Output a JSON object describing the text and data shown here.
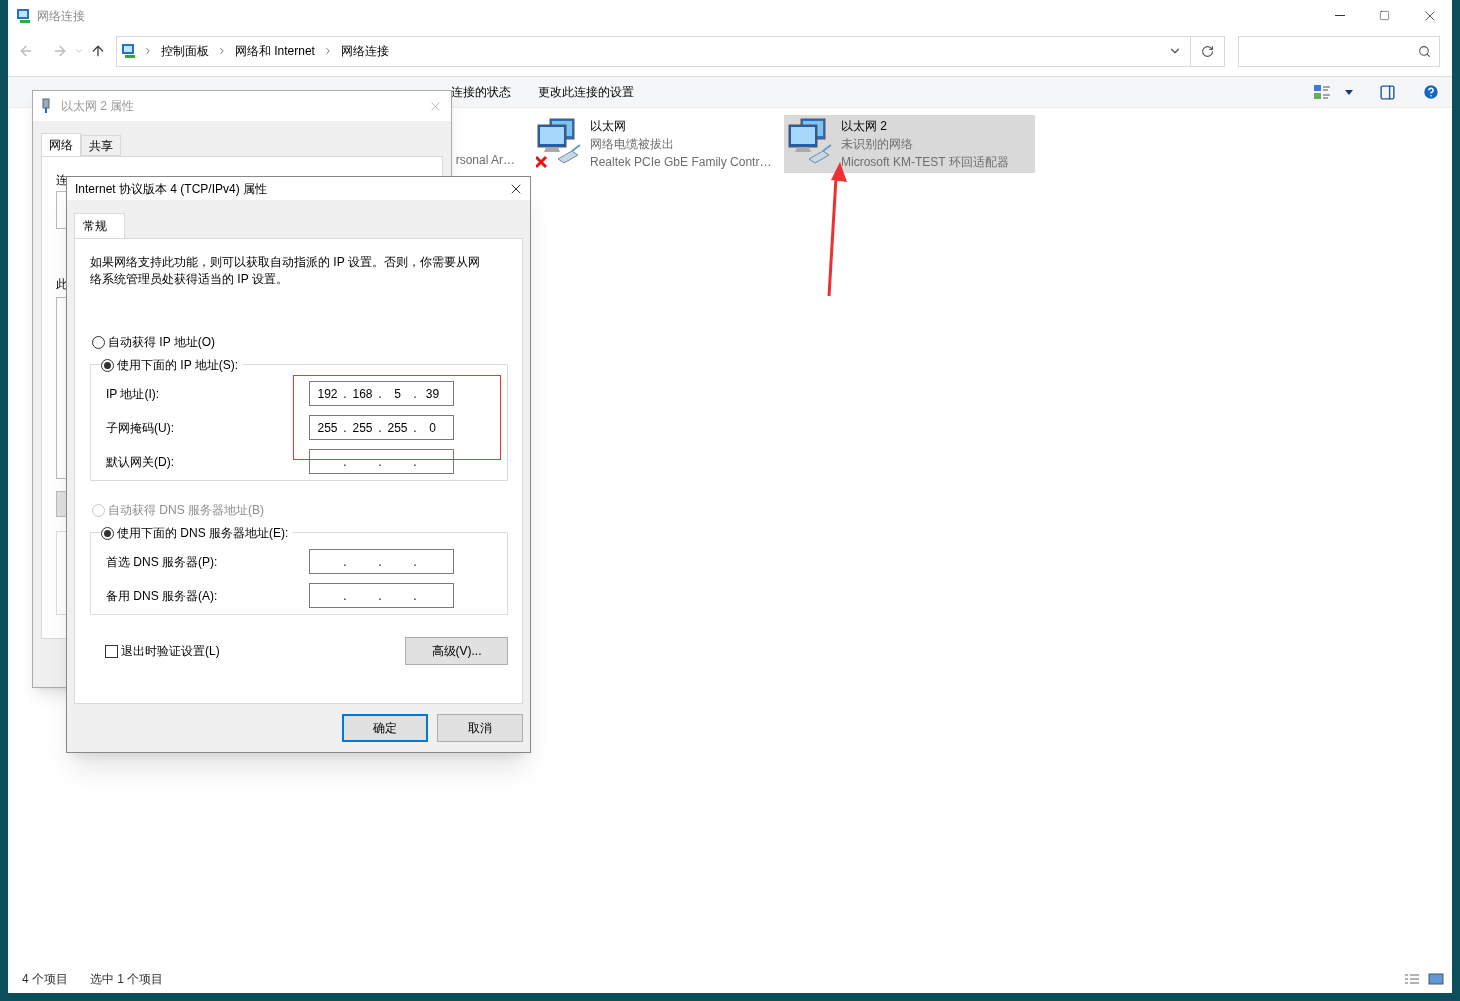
{
  "window": {
    "title": "网络连接"
  },
  "address_bar": {
    "path": [
      "控制面板",
      "网络和 Internet",
      "网络连接"
    ]
  },
  "toolbar": {
    "items": [
      {
        "label": "连接的状态"
      },
      {
        "label": "更改此连接的设置"
      }
    ]
  },
  "connections": [
    {
      "device": "rsonal Ar…",
      "selected": false
    },
    {
      "name": "以太网",
      "status": "网络电缆被拔出",
      "device": "Realtek PCIe GbE Family Contr…",
      "selected": false,
      "disconnected": true
    },
    {
      "name": "以太网 2",
      "status": "未识别的网络",
      "device": "Microsoft KM-TEST 环回适配器",
      "selected": true,
      "disconnected": false
    }
  ],
  "status_bar": {
    "count": "4 个项目",
    "selection": "选中 1 个项目"
  },
  "properties_dialog": {
    "title": "以太网 2 属性",
    "active": false,
    "tabs": [
      {
        "label": "网络",
        "selected": true
      },
      {
        "label": "共享",
        "selected": false
      }
    ],
    "fragments": [
      "连",
      "此"
    ]
  },
  "ipv4_dialog": {
    "title": "Internet 协议版本 4 (TCP/IPv4) 属性",
    "tabs": [
      {
        "label": "常规",
        "selected": true
      }
    ],
    "description": "如果网络支持此功能，则可以获取自动指派的 IP 设置。否则，你需要从网络系统管理员处获得适当的 IP 设置。",
    "octet_separator": ".",
    "ip_options": [
      {
        "label": "自动获得 IP 地址(O)",
        "selected": false,
        "disabled": false
      },
      {
        "label": "使用下面的 IP 地址(S):",
        "selected": true,
        "disabled": false
      }
    ],
    "ip_fields": [
      {
        "label": "IP 地址(I):",
        "octets": [
          "192",
          "168",
          "5",
          "39"
        ]
      },
      {
        "label": "子网掩码(U):",
        "octets": [
          "255",
          "255",
          "255",
          "0"
        ]
      },
      {
        "label": "默认网关(D):"
      }
    ],
    "dns_options": [
      {
        "label": "自动获得 DNS 服务器地址(B)",
        "selected": false,
        "disabled": true
      },
      {
        "label": "使用下面的 DNS 服务器地址(E):",
        "selected": true,
        "disabled": false
      }
    ],
    "dns_fields": [
      {
        "label": "首选 DNS 服务器(P):"
      },
      {
        "label": "备用 DNS 服务器(A):"
      }
    ],
    "validate_on_exit": {
      "label": "退出时验证设置(L)",
      "checked": false
    },
    "advanced_button": "高级(V)...",
    "buttons": [
      {
        "label": "确定",
        "default": true
      },
      {
        "label": "取消",
        "default": false
      }
    ]
  },
  "annotations": {
    "highlight_box": true,
    "arrow": true
  }
}
